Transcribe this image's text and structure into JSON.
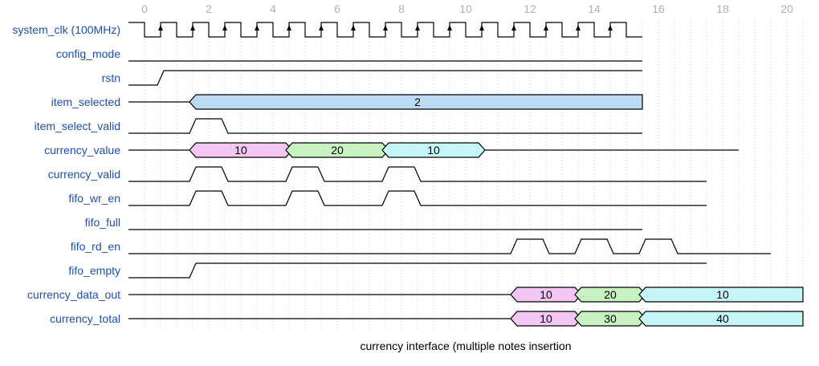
{
  "caption": "currency interface (multiple notes insertion",
  "time_axis": {
    "labels": [
      "0",
      "2",
      "4",
      "6",
      "8",
      "10",
      "12",
      "14",
      "16",
      "18",
      "20"
    ],
    "units_per_label": 2,
    "max_time": 21
  },
  "colors": {
    "label": "#1f4fa8",
    "wave": "#000000",
    "grid": "#c8c8c8",
    "tick": "#b0b0b0",
    "bus_pink": "#f3c6f3",
    "bus_green": "#c9f2c1",
    "bus_cyan": "#c6f6f8",
    "bus_blue": "#bcdcf6"
  },
  "signals": [
    {
      "name": "system_clk (100MHz)",
      "type": "clock",
      "start": 0,
      "end": 16
    },
    {
      "name": "config_mode",
      "type": "bit",
      "end": 16,
      "segs": [
        {
          "t": 0,
          "v": 0
        }
      ]
    },
    {
      "name": "rstn",
      "type": "bit",
      "end": 16,
      "segs": [
        {
          "t": 0,
          "v": 0
        },
        {
          "t": 1,
          "v": 1
        }
      ]
    },
    {
      "name": "item_selected",
      "type": "bus",
      "end": 16,
      "segs": [
        {
          "t": 0,
          "v": null
        },
        {
          "t": 2,
          "v": "2",
          "c": "bus_blue"
        }
      ]
    },
    {
      "name": "item_select_valid",
      "type": "bit",
      "end": 16,
      "segs": [
        {
          "t": 0,
          "v": 0
        },
        {
          "t": 2,
          "v": 1
        },
        {
          "t": 3,
          "v": 0
        }
      ]
    },
    {
      "name": "currency_value",
      "type": "bus",
      "end": 19,
      "segs": [
        {
          "t": 0,
          "v": null
        },
        {
          "t": 2,
          "v": "10",
          "c": "bus_pink"
        },
        {
          "t": 5,
          "v": "20",
          "c": "bus_green"
        },
        {
          "t": 8,
          "v": "10",
          "c": "bus_cyan"
        },
        {
          "t": 11,
          "v": null
        }
      ]
    },
    {
      "name": "currency_valid",
      "type": "bit",
      "end": 18,
      "segs": [
        {
          "t": 0,
          "v": 0
        },
        {
          "t": 2,
          "v": 1
        },
        {
          "t": 3,
          "v": 0
        },
        {
          "t": 5,
          "v": 1
        },
        {
          "t": 6,
          "v": 0
        },
        {
          "t": 8,
          "v": 1
        },
        {
          "t": 9,
          "v": 0
        }
      ]
    },
    {
      "name": "fifo_wr_en",
      "type": "bit",
      "end": 18,
      "segs": [
        {
          "t": 0,
          "v": 0
        },
        {
          "t": 2,
          "v": 1
        },
        {
          "t": 3,
          "v": 0
        },
        {
          "t": 5,
          "v": 1
        },
        {
          "t": 6,
          "v": 0
        },
        {
          "t": 8,
          "v": 1
        },
        {
          "t": 9,
          "v": 0
        }
      ]
    },
    {
      "name": "fifo_full",
      "type": "bit",
      "end": 16,
      "segs": [
        {
          "t": 0,
          "v": 0
        }
      ]
    },
    {
      "name": "fifo_rd_en",
      "type": "bit",
      "end": 20,
      "segs": [
        {
          "t": 0,
          "v": 0
        },
        {
          "t": 12,
          "v": 1
        },
        {
          "t": 13,
          "v": 0
        },
        {
          "t": 14,
          "v": 1
        },
        {
          "t": 15,
          "v": 0
        },
        {
          "t": 16,
          "v": 1
        },
        {
          "t": 17,
          "v": 0
        }
      ]
    },
    {
      "name": "fifo_empty",
      "type": "bit",
      "end": 18,
      "segs": [
        {
          "t": 0,
          "v": 0
        },
        {
          "t": 2,
          "v": 1
        }
      ]
    },
    {
      "name": "currency_data_out",
      "type": "bus",
      "end": 21,
      "segs": [
        {
          "t": 0,
          "v": null
        },
        {
          "t": 12,
          "v": "10",
          "c": "bus_pink"
        },
        {
          "t": 14,
          "v": "20",
          "c": "bus_green"
        },
        {
          "t": 16,
          "v": "10",
          "c": "bus_cyan"
        }
      ]
    },
    {
      "name": "currency_total",
      "type": "bus",
      "end": 21,
      "segs": [
        {
          "t": 0,
          "v": null
        },
        {
          "t": 12,
          "v": "10",
          "c": "bus_pink"
        },
        {
          "t": 14,
          "v": "30",
          "c": "bus_green"
        },
        {
          "t": 16,
          "v": "40",
          "c": "bus_cyan"
        }
      ]
    }
  ]
}
